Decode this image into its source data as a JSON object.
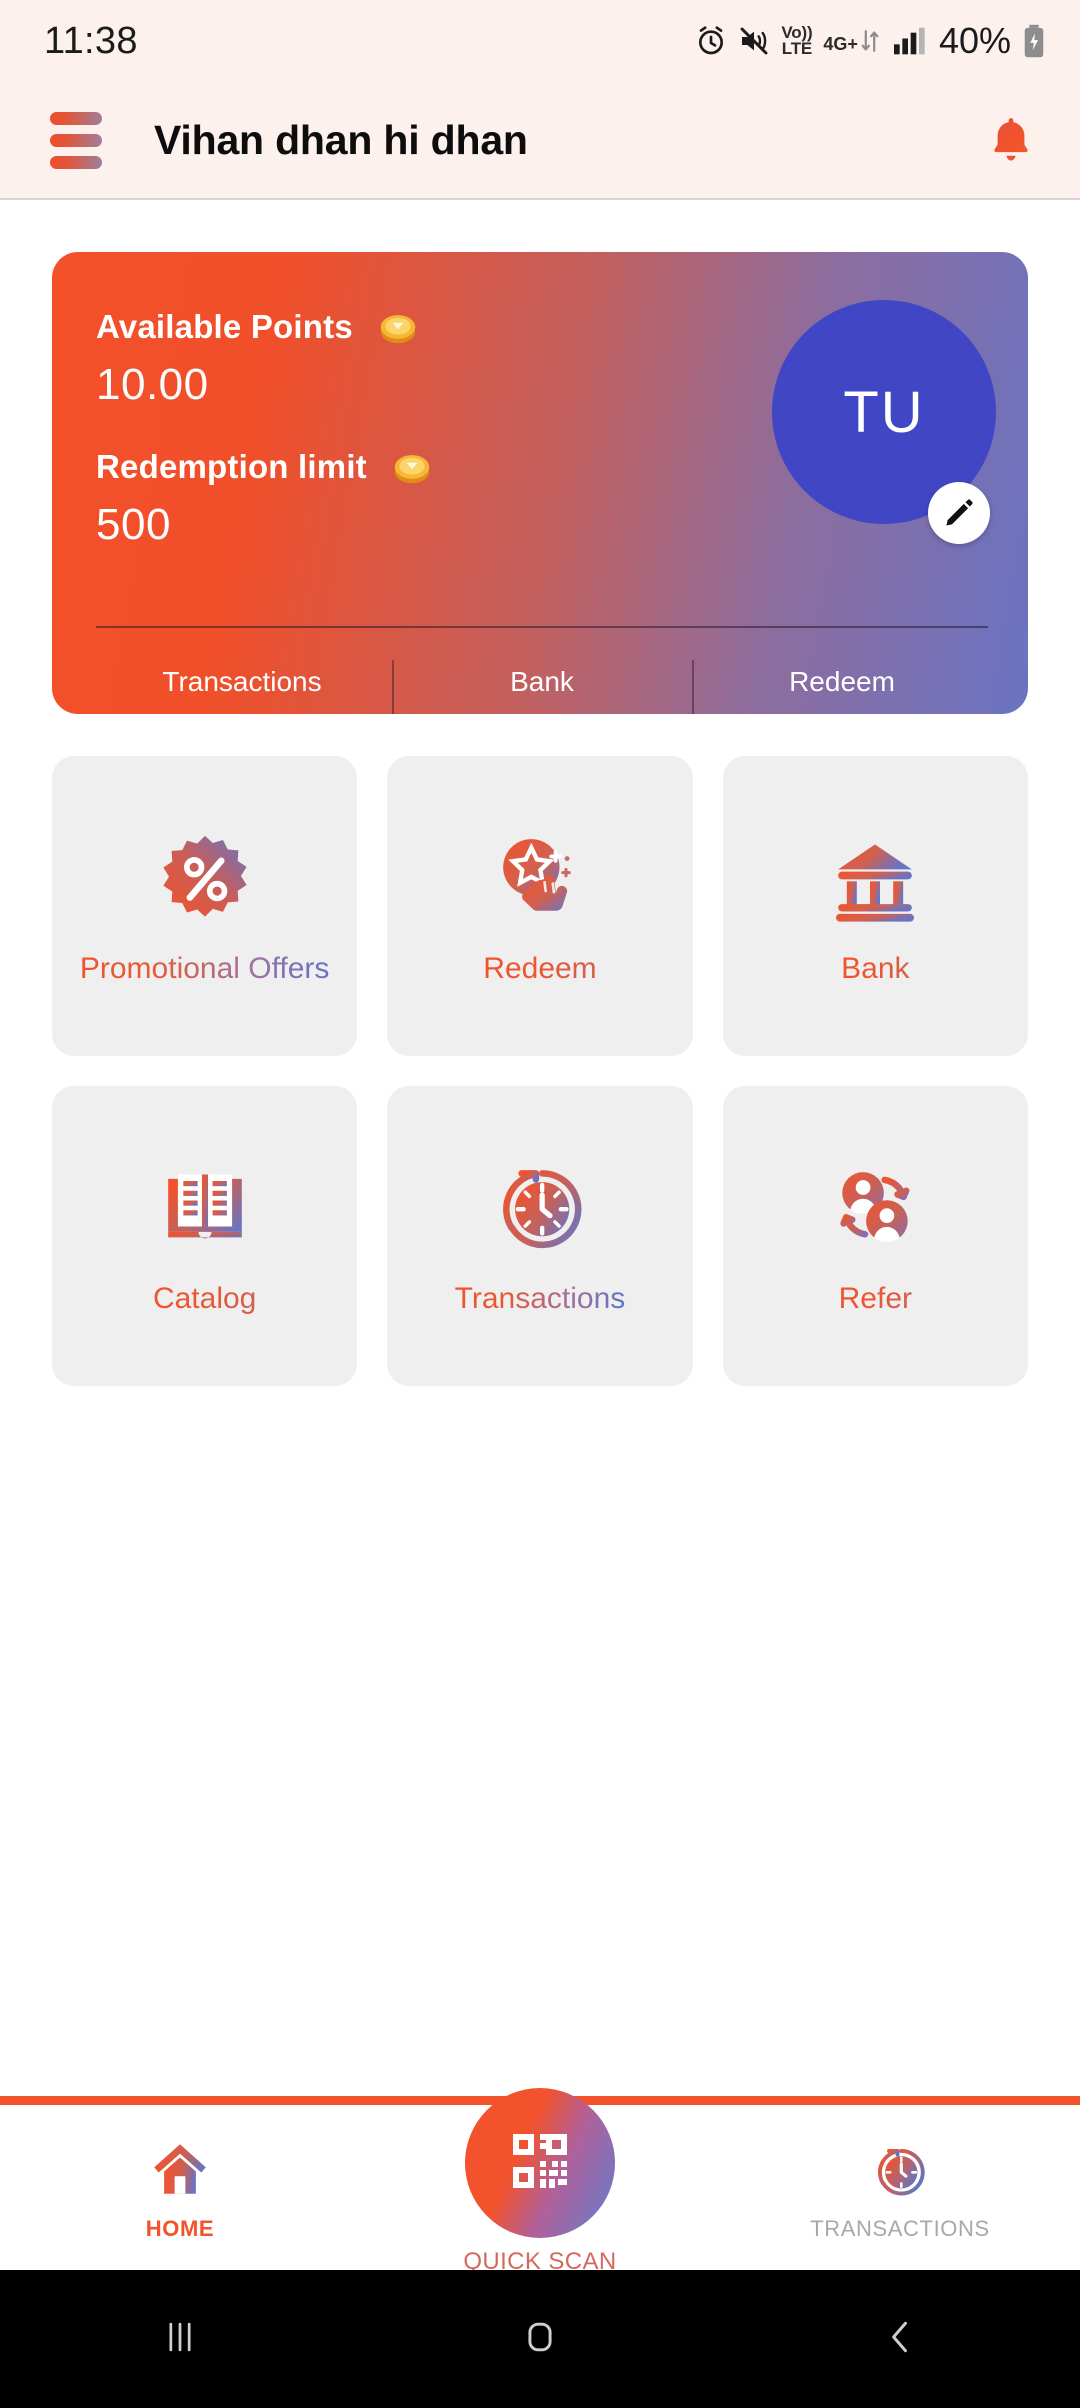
{
  "status_bar": {
    "time": "11:38",
    "battery_percent": "40%",
    "network_volte": "Vo))",
    "network_lte": "LTE",
    "network_gen": "4G+",
    "icons": [
      "alarm-icon",
      "mute-icon",
      "volte-icon",
      "4g-plus-icon",
      "signal-icon",
      "battery-charging-icon"
    ]
  },
  "app_bar": {
    "title": "Vihan dhan hi dhan",
    "menu_icon": "hamburger-menu-icon",
    "notification_icon": "bell-icon"
  },
  "balance_card": {
    "available_points_label": "Available Points",
    "available_points_value": "10.00",
    "redemption_limit_label": "Redemption limit",
    "redemption_limit_value": "500",
    "coin_icon": "gold-coin-icon",
    "avatar_initials": "TU",
    "avatar_color": "#4147c4",
    "edit_icon": "pencil-edit-icon",
    "tabs": [
      {
        "label": "Transactions"
      },
      {
        "label": "Bank"
      },
      {
        "label": "Redeem"
      }
    ]
  },
  "tiles": [
    {
      "label": "Promotional Offers",
      "icon": "percent-badge-icon"
    },
    {
      "label": "Redeem",
      "icon": "star-hand-tap-icon"
    },
    {
      "label": "Bank",
      "icon": "bank-building-icon"
    },
    {
      "label": "Catalog",
      "icon": "open-book-icon"
    },
    {
      "label": "Transactions",
      "icon": "clock-history-icon"
    },
    {
      "label": "Refer",
      "icon": "refer-users-icon"
    }
  ],
  "bottom_nav": {
    "items": [
      {
        "label": "HOME",
        "icon": "home-icon",
        "active": true
      },
      {
        "label": "QUICK SCAN",
        "icon": "qr-code-icon",
        "active": false
      },
      {
        "label": "TRANSACTIONS",
        "icon": "clock-history-icon",
        "active": false
      }
    ]
  },
  "system_nav": {
    "recents": "recents-icon",
    "home": "home-square-icon",
    "back": "back-chevron-icon"
  },
  "theme": {
    "accent": "#f2522c",
    "gradient_end": "#6a73c2",
    "app_bar_bg": "#fdf1ee",
    "tile_bg": "#efefef"
  }
}
